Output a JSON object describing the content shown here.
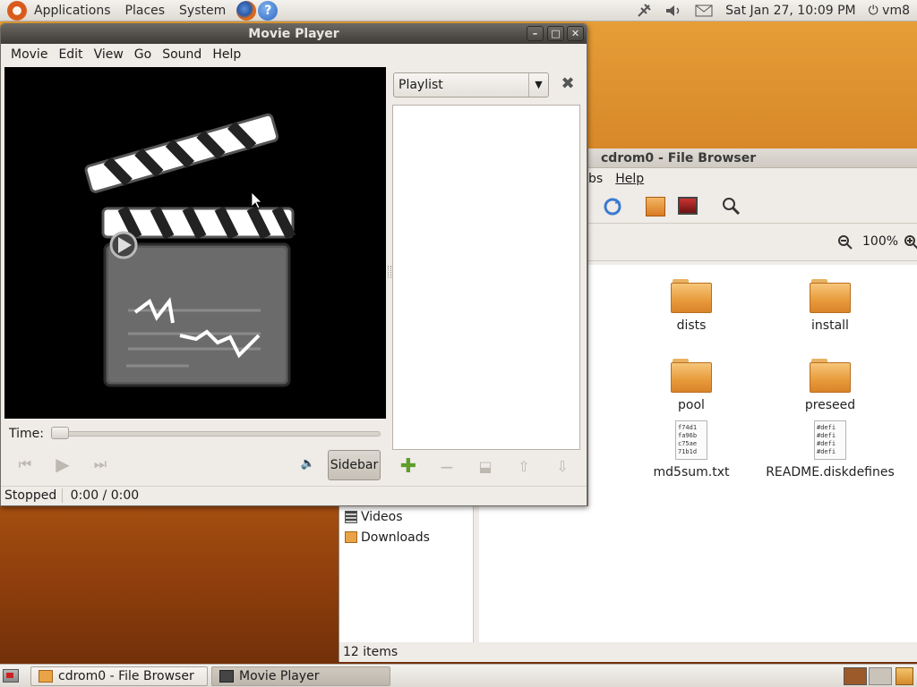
{
  "top_panel": {
    "menus": [
      "Applications",
      "Places",
      "System"
    ],
    "datetime": "Sat Jan 27, 10:09 PM",
    "user": "vm8"
  },
  "file_browser": {
    "title": "cdrom0 - File Browser",
    "menu_partial": "bs",
    "menu_help": "Help",
    "zoom": "100%",
    "files": [
      {
        "name": "dists",
        "type": "folder"
      },
      {
        "name": "install",
        "type": "folder"
      },
      {
        "name": "pool",
        "type": "folder"
      },
      {
        "name": "preseed",
        "type": "folder"
      },
      {
        "name": "md5sum.txt",
        "type": "text",
        "preview": "f74d1\nfa96b\nc75ae\n71b1d"
      },
      {
        "name": "README.diskdefines",
        "type": "text",
        "preview": "#defi\n#defi\n#defi\n#defi"
      }
    ],
    "sidebar_places": [
      "Videos",
      "Downloads"
    ],
    "status": "12 items"
  },
  "movie_player": {
    "title": "Movie Player",
    "menus": [
      "Movie",
      "Edit",
      "View",
      "Go",
      "Sound",
      "Help"
    ],
    "time_label": "Time:",
    "sidebar_button": "Sidebar",
    "playlist_select": "Playlist",
    "status": "Stopped",
    "time": "0:00 / 0:00",
    "seek_position": 0
  },
  "taskbar": {
    "tasks": [
      "cdrom0 - File Browser",
      "Movie Player"
    ]
  }
}
